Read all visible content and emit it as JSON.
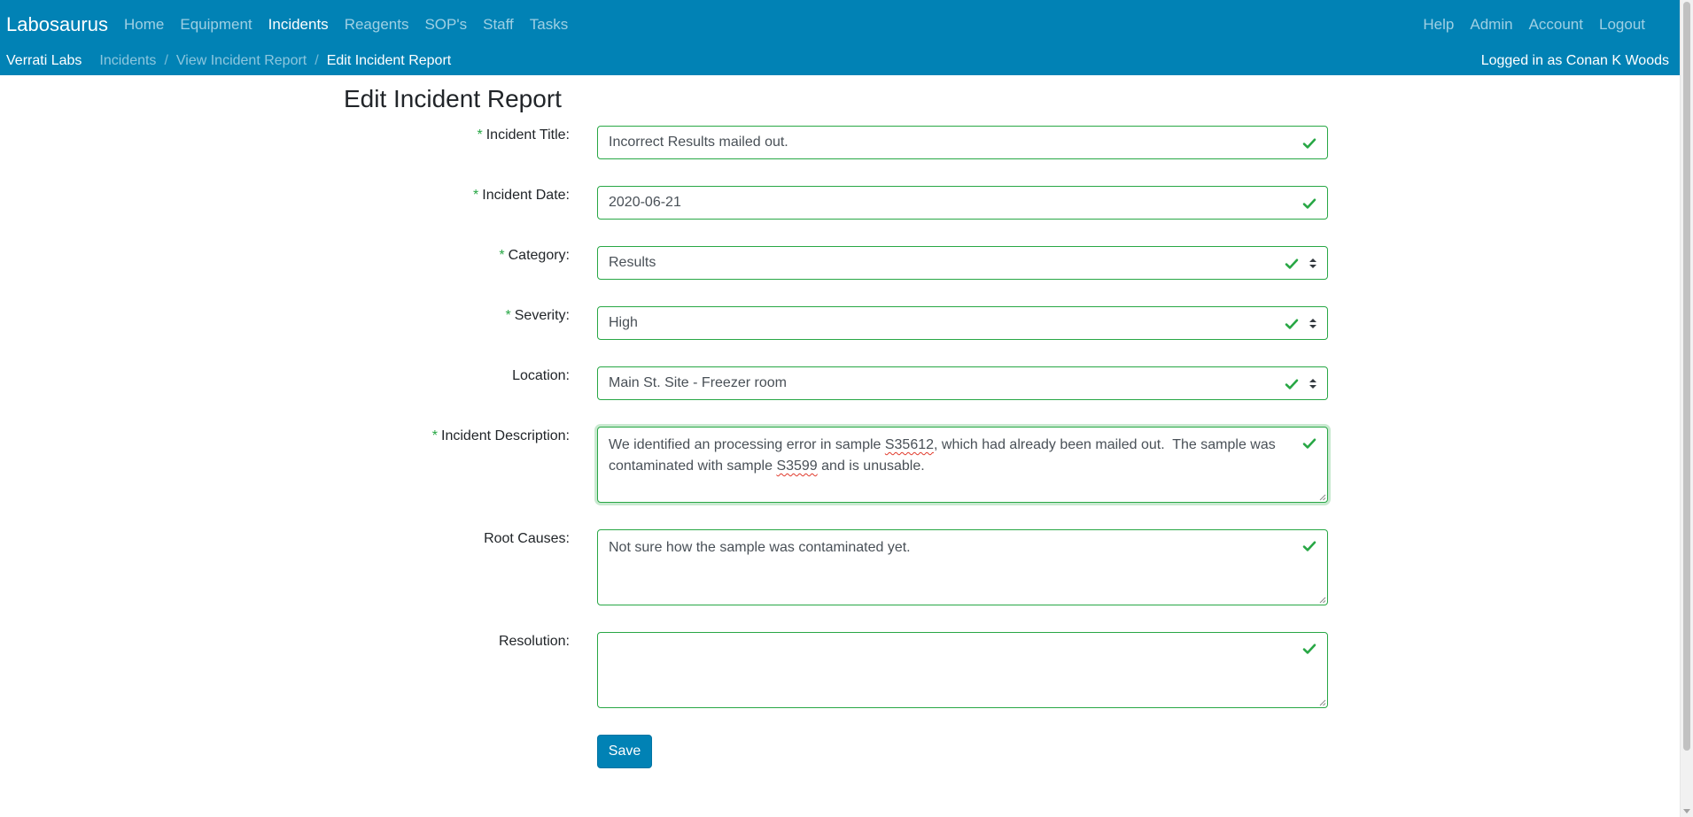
{
  "navbar": {
    "brand": "Labosaurus",
    "left_links": [
      {
        "label": "Home",
        "active": false
      },
      {
        "label": "Equipment",
        "active": false
      },
      {
        "label": "Incidents",
        "active": true
      },
      {
        "label": "Reagents",
        "active": false
      },
      {
        "label": "SOP's",
        "active": false
      },
      {
        "label": "Staff",
        "active": false
      },
      {
        "label": "Tasks",
        "active": false
      }
    ],
    "right_links": [
      {
        "label": "Help"
      },
      {
        "label": "Admin"
      },
      {
        "label": "Account"
      },
      {
        "label": "Logout"
      }
    ]
  },
  "subbar": {
    "site": "Verrati Labs",
    "breadcrumbs": [
      "Incidents",
      "View Incident Report",
      "Edit Incident Report"
    ],
    "separator": "/",
    "logged_in": "Logged in as Conan K Woods"
  },
  "form": {
    "title": "Edit Incident Report",
    "required_marker": "*",
    "incident_title": {
      "label": "Incident Title:",
      "value": "Incorrect Results mailed out.",
      "required": true
    },
    "incident_date": {
      "label": "Incident Date:",
      "value": "2020-06-21",
      "required": true
    },
    "category": {
      "label": "Category:",
      "value": "Results",
      "required": true
    },
    "severity": {
      "label": "Severity:",
      "value": "High",
      "required": true
    },
    "location": {
      "label": "Location:",
      "value": "Main St. Site - Freezer room",
      "required": false
    },
    "description": {
      "label": "Incident Description:",
      "required": true,
      "parts": [
        "We identified an processing error in sample ",
        "S35612",
        ", which had already been mailed out.  The sample was contaminated with sample ",
        "S3599",
        " and is unusable."
      ]
    },
    "root_causes": {
      "label": "Root Causes:",
      "value": "Not sure how the sample was contaminated yet.",
      "required": false
    },
    "resolution": {
      "label": "Resolution:",
      "value": "",
      "required": false
    },
    "save_label": "Save"
  },
  "colors": {
    "navbar_bg": "#0182b5",
    "valid_green": "#28a745",
    "button_bg": "#0182b5"
  },
  "icons": {
    "valid": "check-icon",
    "select": "chevron-up-down-icon",
    "resize": "resize-grip-icon"
  }
}
